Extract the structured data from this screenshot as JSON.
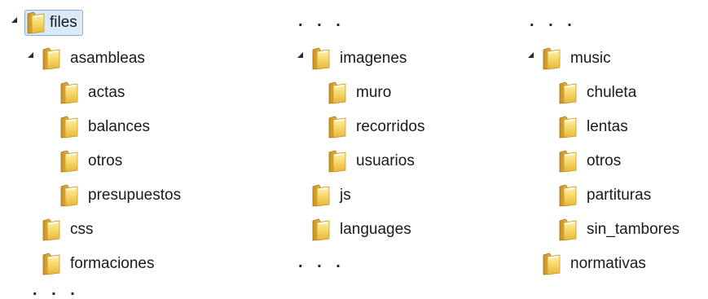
{
  "tree": {
    "root": {
      "label": "files",
      "expanded": true,
      "selected": true
    },
    "col1": {
      "asambleas": {
        "label": "asambleas",
        "expanded": true,
        "children": [
          "actas",
          "balances",
          "otros",
          "presupuestos"
        ]
      },
      "css": "css",
      "formaciones": "formaciones",
      "more": ". . ."
    },
    "col2": {
      "more_top": ". . .",
      "imagenes": {
        "label": "imagenes",
        "expanded": true,
        "children": [
          "muro",
          "recorridos",
          "usuarios"
        ]
      },
      "js": "js",
      "languages": "languages",
      "more_bottom": ". . ."
    },
    "col3": {
      "more_top": ". . .",
      "music": {
        "label": "music",
        "expanded": true,
        "children": [
          "chuleta",
          "lentas",
          "otros",
          "partituras",
          "sin_tambores"
        ]
      },
      "normativas": "normativas"
    }
  },
  "icons": {
    "folder": "folder-icon",
    "expanded": "expanded-triangle-icon"
  },
  "colors": {
    "selection_bg": "#d9ebf9",
    "selection_border": "#84acdd",
    "folder_front": "#f3d25a",
    "folder_back": "#d7a62e"
  }
}
